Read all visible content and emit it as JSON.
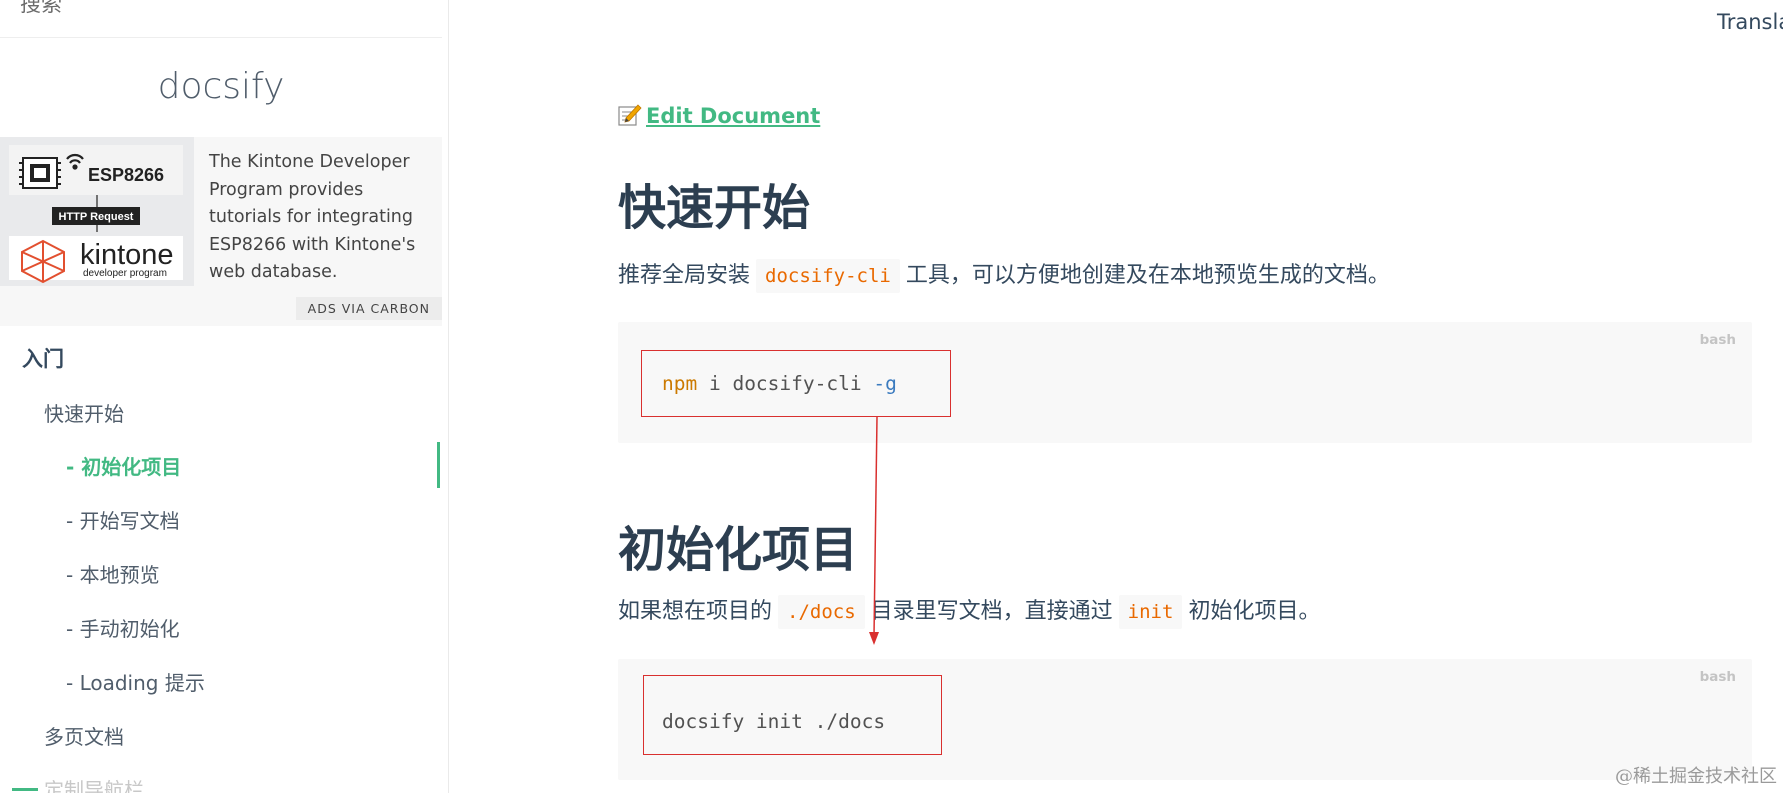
{
  "sidebar": {
    "search_text": "搜索",
    "app_name": "docsify",
    "ad": {
      "image_labels": {
        "chip": "ESP8266",
        "request": "HTTP Request",
        "brand": "kintone",
        "brand_sub": "developer program"
      },
      "text": "The Kintone Developer Program provides tutorials for integrating ESP8266 with Kintone's web database.",
      "via": "ADS VIA CARBON"
    },
    "section_title": "入门",
    "items": [
      {
        "label": "快速开始"
      },
      {
        "label": "- 初始化项目",
        "active": true
      },
      {
        "label": "- 开始写文档"
      },
      {
        "label": "- 本地预览"
      },
      {
        "label": "- 手动初始化"
      },
      {
        "label": "- Loading 提示"
      },
      {
        "label": "多页文档"
      },
      {
        "label": "定制导航栏"
      }
    ]
  },
  "content": {
    "translate": "Transla",
    "edit_link": "Edit Document",
    "sections": [
      {
        "heading": "快速开始",
        "para_before": "推荐全局安装",
        "code": "docsify-cli",
        "para_after": "工具，可以方便地创建及在本地预览生成的文档。",
        "block": {
          "lang": "bash",
          "cmd": "npm",
          "arg": " i docsify-cli ",
          "flag": "-g"
        }
      },
      {
        "heading": "初始化项目",
        "para_before": "如果想在项目的",
        "code": "./docs",
        "para_mid": "目录里写文档，直接通过",
        "code2": "init",
        "para_after": "初始化项目。",
        "block": {
          "lang": "bash",
          "text": "docsify init ./docs"
        }
      }
    ]
  },
  "watermark": "@稀土掘金技术社区",
  "colors": {
    "accent": "#42b983",
    "annotation_red": "#d9302f",
    "inline_code": "#e96900"
  }
}
